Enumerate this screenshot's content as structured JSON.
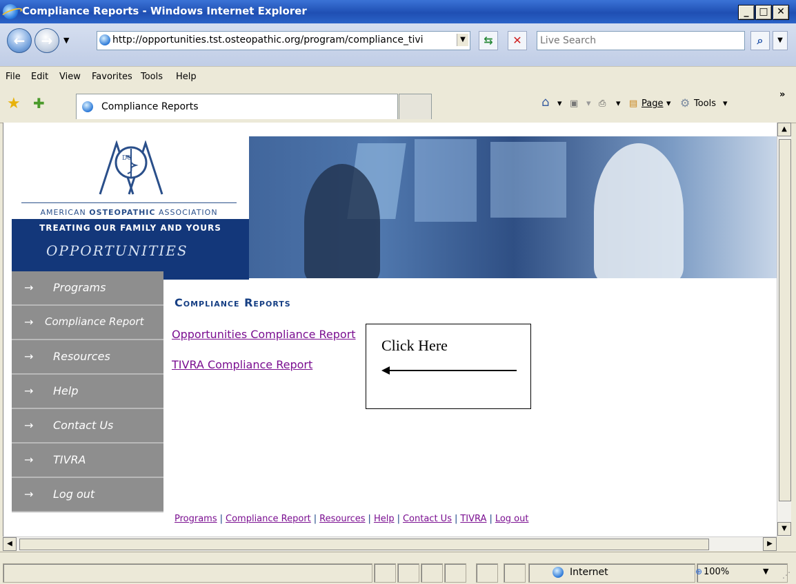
{
  "window": {
    "title": "Compliance Reports - Windows Internet Explorer"
  },
  "address_bar": {
    "url": "http://opportunities.tst.osteopathic.org/program/compliance_tivi"
  },
  "search": {
    "placeholder": "Live Search"
  },
  "menu": [
    "File",
    "Edit",
    "View",
    "Favorites",
    "Tools",
    "Help"
  ],
  "tab": {
    "title": "Compliance Reports"
  },
  "command_bar": {
    "page_label": "Page",
    "tools_label": "Tools"
  },
  "site": {
    "association": {
      "prefix": "AMERICAN ",
      "bold": "OSTEOPATHIC",
      "suffix": " ASSOCIATION"
    },
    "tagline": "TREATING OUR FAMILY AND YOURS",
    "brand": "OPPORTUNITIES",
    "logo_letters": "DO"
  },
  "nav": [
    {
      "label": "Programs"
    },
    {
      "label": "Compliance Report"
    },
    {
      "label": "Resources"
    },
    {
      "label": "Help"
    },
    {
      "label": "Contact Us"
    },
    {
      "label": "TIVRA"
    },
    {
      "label": "Log out"
    }
  ],
  "nav_arrow": "→",
  "main": {
    "heading": "Compliance Reports",
    "links": [
      "Opportunities Compliance Report",
      "TIVRA Compliance Report"
    ]
  },
  "callout": {
    "text": "Click Here"
  },
  "footer_links": [
    "Programs",
    "Compliance Report",
    "Resources",
    "Help",
    "Contact Us",
    "TIVRA",
    "Log out"
  ],
  "status_bar": {
    "zone": "Internet",
    "zoom": "100%"
  }
}
